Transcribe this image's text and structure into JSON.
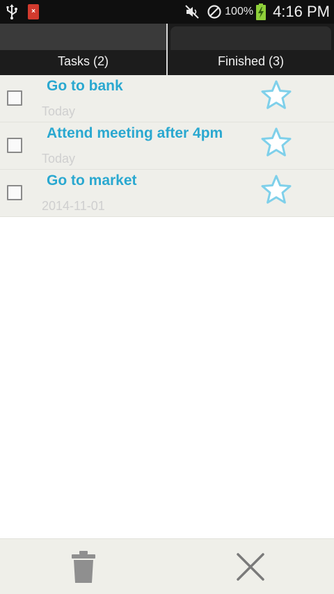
{
  "status_bar": {
    "icons_left": [
      "usb-icon",
      "app-notification-icon"
    ],
    "notification_glyph": "×",
    "icons_right": [
      "mute-icon",
      "blocking-mode-icon",
      "battery-charging-icon"
    ],
    "battery": "100%",
    "time": "4:16 PM"
  },
  "tabs": [
    {
      "label": "Tasks (2)",
      "selected": true
    },
    {
      "label": "Finished (3)",
      "selected": false
    }
  ],
  "tasks": [
    {
      "title": "Go to bank",
      "date": "Today",
      "checked": false,
      "starred": false
    },
    {
      "title": "Attend meeting after 4pm",
      "date": "Today",
      "checked": false,
      "starred": false
    },
    {
      "title": "Go to market",
      "date": "2014-11-01",
      "checked": false,
      "starred": false
    }
  ],
  "bottom_bar": {
    "actions": [
      "trash-icon",
      "close-icon"
    ]
  },
  "colors": {
    "accent": "#2aa8d0",
    "star": "#7fd0ea",
    "row_bg": "#efefea",
    "status_bar": "#0f0f0f"
  }
}
